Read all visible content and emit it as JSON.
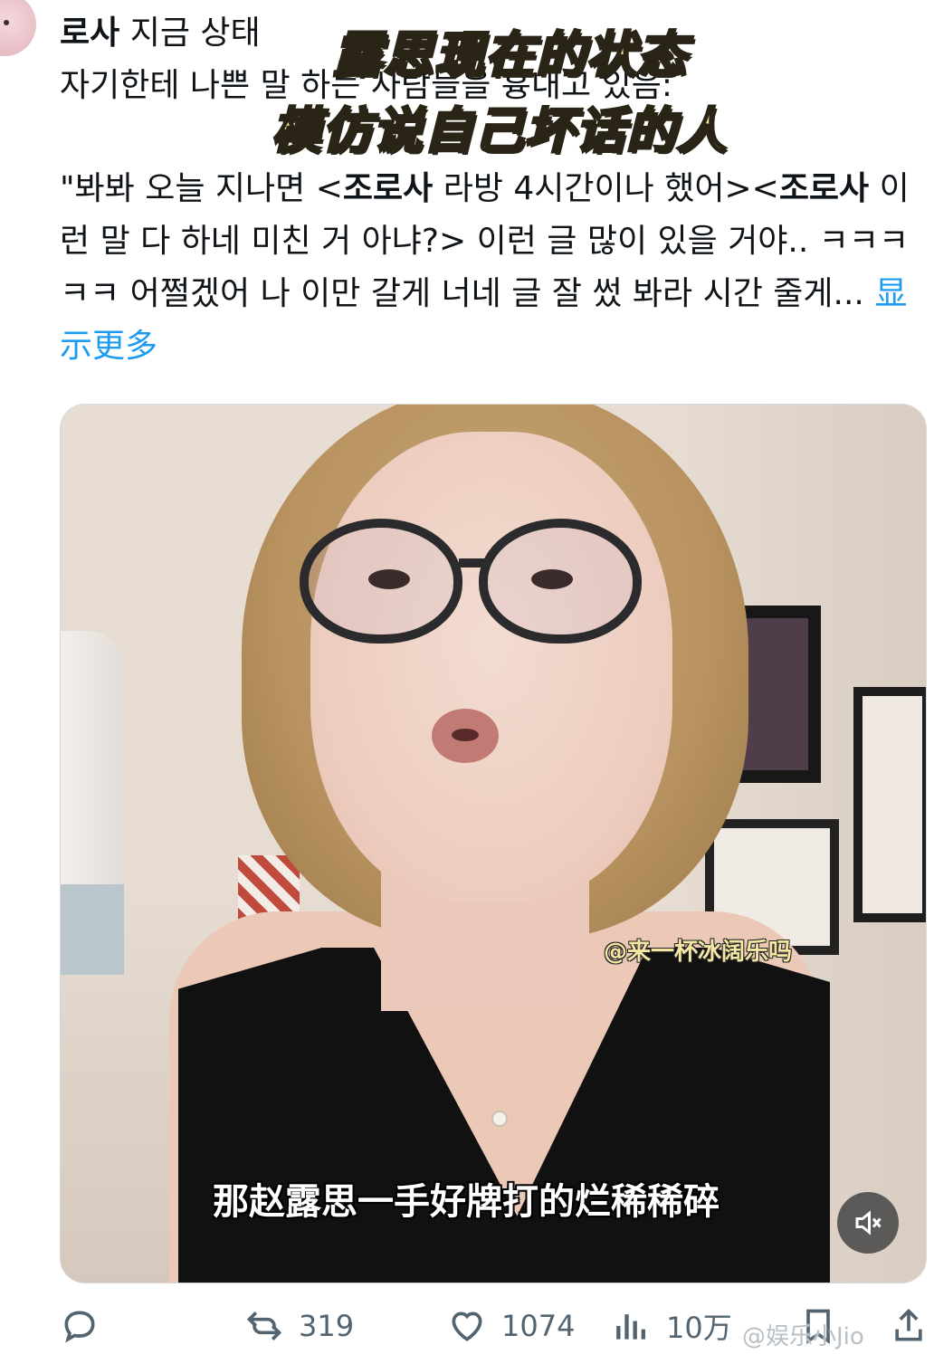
{
  "header": {
    "author": "로사",
    "title_rest": "지금 상태",
    "line2": "자기한테 나쁜 말 하는 사람들을 흉내고 있음:"
  },
  "captions": {
    "line1": "露思现在的状态",
    "line2": "模仿说自己坏话的人"
  },
  "tweet": {
    "p1": "\"봐봐 오늘 지나면 <",
    "b1": "조로사",
    "p2": " 라방 4시간이나 했어><",
    "b2": "조로사",
    "p3": " 이런 말 다 하네 미친 거 아냐?> 이런 글 많이 있을 거야.. ㅋㅋㅋㅋㅋ 어쩔겠어 나 이만 갈게 너네 글 잘 썼 봐라 시간 줄게...",
    "show_more": "显示更多"
  },
  "media": {
    "watermark_tag": "@来一杯冰阔乐吗",
    "subtitle": "那赵露思一手好牌打的烂稀稀碎",
    "mute_icon": "speaker-muted-icon"
  },
  "actions": {
    "replies": "",
    "retweets": "319",
    "likes": "1074",
    "views": "10万"
  },
  "watermark": "@娱乐小Jio",
  "colors": {
    "link": "#1d9bf0",
    "text": "#0f1419",
    "muted": "#536471",
    "caption_fill": "#f1e28a"
  }
}
